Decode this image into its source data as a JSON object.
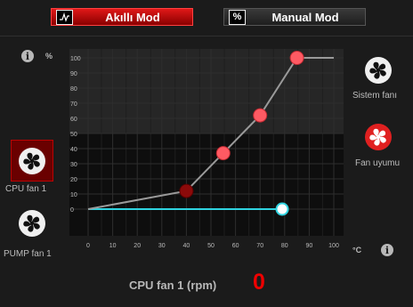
{
  "modes": {
    "smart": {
      "label": "Akıllı Mod",
      "icon": "fan-curve-icon"
    },
    "manual": {
      "label": "Manual Mod",
      "icon": "percent-icon",
      "icon_glyph": "%"
    }
  },
  "chart_axis": {
    "y_unit": "%",
    "x_unit": "°C"
  },
  "left_fans": [
    {
      "label": "CPU fan 1",
      "selected": true
    },
    {
      "label": "PUMP fan 1",
      "selected": false
    }
  ],
  "right_fans": [
    {
      "label": "Sistem fanı"
    },
    {
      "label": "Fan uyumu"
    }
  ],
  "footer": {
    "label": "CPU fan 1 (rpm)",
    "value": "0"
  },
  "colors": {
    "accent": "#e01818",
    "curve_point": "#ff5a63",
    "curve_point_dark": "#8b0a0a",
    "current_line": "#2fd3e0"
  },
  "chart_data": {
    "type": "line",
    "x_ticks": [
      0,
      10,
      20,
      30,
      40,
      50,
      60,
      70,
      80,
      90,
      100
    ],
    "y_ticks": [
      0,
      10,
      20,
      30,
      40,
      50,
      60,
      70,
      80,
      90,
      100
    ],
    "xlim": [
      0,
      100
    ],
    "ylim": [
      0,
      100
    ],
    "grid": true,
    "curve": {
      "x": [
        0,
        40,
        55,
        70,
        85,
        100
      ],
      "y": [
        0,
        12,
        37,
        62,
        100,
        100
      ],
      "handles": [
        {
          "x": 40,
          "y": 12
        },
        {
          "x": 55,
          "y": 37
        },
        {
          "x": 70,
          "y": 62
        },
        {
          "x": 85,
          "y": 100
        }
      ]
    },
    "current_temperature": {
      "x": [
        0,
        79
      ],
      "y": 0
    }
  }
}
